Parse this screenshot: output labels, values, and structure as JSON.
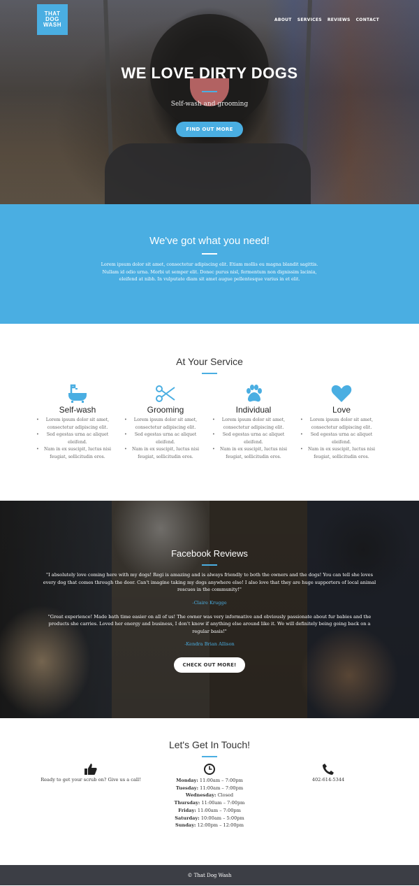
{
  "brand": {
    "lines": [
      "THAT",
      "DOG",
      "WASH"
    ]
  },
  "nav": {
    "items": [
      "ABOUT",
      "SERVICES",
      "REVIEWS",
      "CONTACT"
    ]
  },
  "hero": {
    "title": "WE LOVE DIRTY DOGS",
    "subtitle": "Self-wash and grooming",
    "cta_label": "FIND OUT MORE"
  },
  "need": {
    "title": "We've got what you need!",
    "body": "Lorem ipsum dolor sit amet, consectetur adipiscing elit. Etiam mollis eu magna blandit sagittis. Nullam id odio urna. Morbi ut semper elit. Donec purus nisl, fermentum non dignissim lacinia, eleifend at nibh. In vulputate diam sit amet augue pellentesque varius in et elit."
  },
  "services": {
    "title": "At Your Service",
    "items": [
      {
        "name": "Self-wash",
        "icon": "bathtub-icon",
        "bullets": [
          "Lorem ipsum dolor sit amet, consectetur adipiscing elit.",
          "Sed egestas urna ac aliquet eleifend.",
          "Nam in ex suscipit, luctus nisi feugiat, sollicitudin eros."
        ]
      },
      {
        "name": "Grooming",
        "icon": "scissors-icon",
        "bullets": [
          "Lorem ipsum dolor sit amet, consectetur adipiscing elit.",
          "Sed egestas urna ac aliquet eleifend.",
          "Nam in ex suscipit, luctus nisi feugiat, sollicitudin eros."
        ]
      },
      {
        "name": "Individual",
        "icon": "paw-icon",
        "bullets": [
          "Lorem ipsum dolor sit amet, consectetur adipiscing elit.",
          "Sed egestas urna ac aliquet eleifend.",
          "Nam in ex suscipit, luctus nisi feugiat, sollicitudin eros."
        ]
      },
      {
        "name": "Love",
        "icon": "heart-icon",
        "bullets": [
          "Lorem ipsum dolor sit amet, consectetur adipiscing elit.",
          "Sed egestas urna ac aliquet eleifend.",
          "Nam in ex suscipit, luctus nisi feugiat, sollicitudin eros."
        ]
      }
    ]
  },
  "reviews": {
    "title": "Facebook Reviews",
    "items": [
      {
        "quote": "\"I absolutely love coming here with my dogs! Regi is amazing and is always friendly to both the owners and the dogs! You can tell she loves every dog that comes through the door. Can't imagine taking my dogs anywhere else! I also love that they are huge supporters of local animal rescues in the community!\"",
        "author": "-Claire Krugge"
      },
      {
        "quote": "\"Great experience! Made bath time easier on all of us! The owner was very informative and obviously passionate about fur babies and the products she carries. Loved her energy and business, I don't know if anything else around like it. We will definitely being going back on a regular basis!\"",
        "author": "-Kendra Brian Allison"
      }
    ],
    "cta_label": "CHECK OUT MORE!"
  },
  "contact": {
    "title": "Let's Get In Touch!",
    "call_text": "Ready to get your scrub on? Give us a call!",
    "call_icon": "thumbs-up-icon",
    "hours_icon": "clock-icon",
    "phone_icon": "phone-icon",
    "phone": "402-614-5344",
    "hours": [
      {
        "day": "Monday:",
        "time": "11:00am – 7:00pm"
      },
      {
        "day": "Tuesday:",
        "time": "11:00am – 7:00pm"
      },
      {
        "day": "Wednesday:",
        "time": "Closed"
      },
      {
        "day": "Thursday:",
        "time": "11:00am – 7:00pm"
      },
      {
        "day": "Friday:",
        "time": "11:00am – 7:00pm"
      },
      {
        "day": "Saturday:",
        "time": "10:00am – 5:00pm"
      },
      {
        "day": "Sunday:",
        "time": "12:00pm – 12:00pm"
      }
    ]
  },
  "footer": {
    "text": "© That Dog Wash"
  },
  "colors": {
    "accent": "#4aaee2",
    "footer": "#3c3e45"
  }
}
